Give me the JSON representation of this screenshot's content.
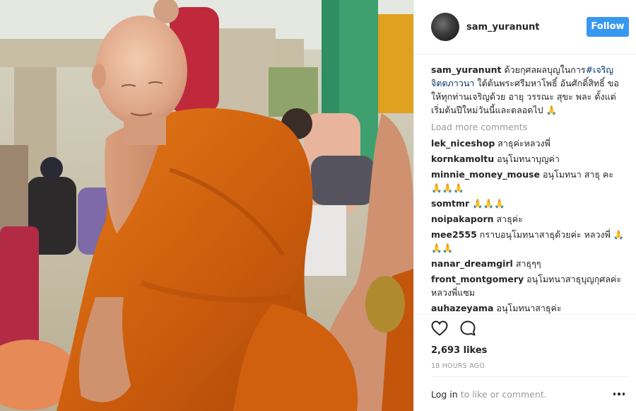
{
  "post": {
    "username": "sam_yuranunt",
    "follow_label": "Follow",
    "caption": {
      "username": "sam_yuranunt",
      "text_before": "ด้วยกุศลผลบุญในการ",
      "hashtag": "#เจริญจิตตภาวนา",
      "text_after": " ใต้ต้นพระศรีมหาโพธิ์ อันศักดิ์สิทธิ์ ขอให้ทุกท่านเจริญด้วย อายุ วรรณะ สุขะ พละ ตั้งแต่เริ่มต้นปีใหม่วันนี้และตลอดไป 🙏"
    },
    "load_more_label": "Load more comments",
    "comments": [
      {
        "user": "lek_niceshop",
        "text": "สาธุค่ะหลวงพี่"
      },
      {
        "user": "kornkamoltu",
        "text": "อนุโมทนาบุญค่า"
      },
      {
        "user": "minnie_money_mouse",
        "text": "อนุโมทนา สาธุ คะ 🙏🙏🙏"
      },
      {
        "user": "somtmr",
        "text": "🙏🙏🙏"
      },
      {
        "user": "noipakaporn",
        "text": "สาธุค่ะ"
      },
      {
        "user": "mee2555",
        "text": "กราบอนุโมทนาสาธุด้วยค่ะ หลวงพี่ 🙏🙏🙏"
      },
      {
        "user": "nanar_dreamgirl",
        "text": "สาธุๆๆ"
      },
      {
        "user": "front_montgomery",
        "text": "อนุโมทนาสาธุบุญกุศลค่ะ หลวงพี่แซม"
      },
      {
        "user": "auhazeyama",
        "text": "อนุโมทนาสาธุค่ะ"
      }
    ],
    "likes_label": "2,693 likes",
    "timestamp": "18 HOURS AGO",
    "login_link": "Log in",
    "login_suffix": " to like or comment."
  },
  "icons": {
    "like": "heart-icon",
    "comment": "speech-bubble-icon",
    "more": "more-options-icon"
  },
  "colors": {
    "follow_button": "#3897f0",
    "hashtag": "#003569",
    "muted_text": "#999999",
    "robe": "#d96a12"
  }
}
